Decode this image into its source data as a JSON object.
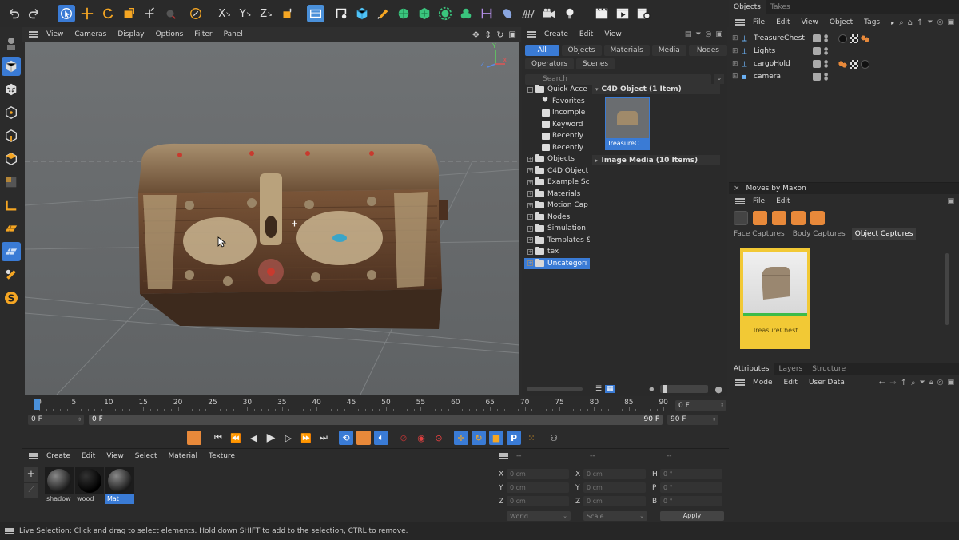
{
  "top_menu": {
    "items": [
      "View",
      "Cameras",
      "Display",
      "Options",
      "Filter",
      "Panel"
    ]
  },
  "viewport": {
    "axis_labels": {
      "x": "X",
      "y": "Y",
      "z": "Z"
    }
  },
  "content_browser": {
    "menu": [
      "Create",
      "Edit",
      "View"
    ],
    "tabs_row1": [
      "All",
      "Objects",
      "Materials",
      "Media",
      "Nodes"
    ],
    "tabs_row2": [
      "Operators",
      "Scenes"
    ],
    "search_placeholder": "Search",
    "tree": [
      {
        "label": "Quick Acce",
        "level": 0,
        "expanded": true
      },
      {
        "label": "Favorites",
        "level": 1,
        "kind": "heart"
      },
      {
        "label": "Incomple",
        "level": 1
      },
      {
        "label": "Keyword",
        "level": 1
      },
      {
        "label": "Recently",
        "level": 1
      },
      {
        "label": "Recently",
        "level": 1
      },
      {
        "label": "Objects",
        "level": 0
      },
      {
        "label": "C4D Object",
        "level": 0
      },
      {
        "label": "Example Sc",
        "level": 0
      },
      {
        "label": "Materials",
        "level": 0
      },
      {
        "label": "Motion Cap",
        "level": 0
      },
      {
        "label": "Nodes",
        "level": 0
      },
      {
        "label": "Simulation",
        "level": 0
      },
      {
        "label": "Templates &",
        "level": 0
      },
      {
        "label": "tex",
        "level": 0
      },
      {
        "label": "Uncategori",
        "level": 0,
        "selected": true
      }
    ],
    "section_c4d": "C4D Object (1 Item)",
    "asset_label": "TreasureC...",
    "section_media": "Image Media (10 Items)"
  },
  "objects_panel": {
    "tabs": [
      "Objects",
      "Takes"
    ],
    "menu": [
      "File",
      "Edit",
      "View",
      "Object",
      "Tags"
    ],
    "rows": [
      {
        "name": "TreasureChest",
        "icon": "null-object-icon",
        "tags": [
          "black-sphere",
          "checker",
          "orange"
        ]
      },
      {
        "name": "Lights",
        "icon": "null-object-icon",
        "tags": []
      },
      {
        "name": "cargoHold",
        "icon": "null-object-icon",
        "tags": [
          "orange",
          "checker",
          "black-sphere"
        ]
      },
      {
        "name": "camera",
        "icon": "camera-icon",
        "tags": []
      }
    ]
  },
  "moves_panel": {
    "title": "Moves by Maxon",
    "menu": [
      "File",
      "Edit"
    ],
    "tabs": [
      "Face Captures",
      "Body Captures",
      "Object Captures"
    ],
    "active_tab": "Object Captures",
    "capture_label": "TreasureChest"
  },
  "attributes_panel": {
    "tabs": [
      "Attributes",
      "Layers",
      "Structure"
    ],
    "menu": [
      "Mode",
      "Edit",
      "User Data"
    ]
  },
  "timeline": {
    "ticks": [
      "0",
      "5",
      "10",
      "15",
      "20",
      "25",
      "30",
      "35",
      "40",
      "45",
      "50",
      "55",
      "60",
      "65",
      "70",
      "75",
      "80",
      "85",
      "90"
    ],
    "start_field": "0 F",
    "range_start": "0 F",
    "range_end": "90 F",
    "current_frame": "0 F",
    "end_field": "90 F"
  },
  "material_manager": {
    "menu": [
      "Create",
      "Edit",
      "View",
      "Select",
      "Material",
      "Texture"
    ],
    "materials": [
      {
        "name": "shadow"
      },
      {
        "name": "wood"
      },
      {
        "name": "Mat",
        "selected": true
      }
    ]
  },
  "coordinates": {
    "header": [
      "--",
      "--",
      "--"
    ],
    "rows": [
      {
        "a_label": "X",
        "a_value": "0 cm",
        "b_label": "X",
        "b_value": "0 cm",
        "c_label": "H",
        "c_value": "0 °"
      },
      {
        "a_label": "Y",
        "a_value": "0 cm",
        "b_label": "Y",
        "b_value": "0 cm",
        "c_label": "P",
        "c_value": "0 °"
      },
      {
        "a_label": "Z",
        "a_value": "0 cm",
        "b_label": "Z",
        "b_value": "0 cm",
        "c_label": "B",
        "c_value": "0 °"
      }
    ],
    "world_select": "World",
    "scale_select": "Scale",
    "apply_label": "Apply"
  },
  "status_bar": {
    "text": "Live Selection: Click and drag to select elements. Hold down SHIFT to add to the selection, CTRL to remove."
  },
  "colors": {
    "accent_blue": "#3a7bd5",
    "viewport_bg": "#6b6e70",
    "capture_yellow": "#f2c935",
    "capture_green": "#3dbb4a"
  }
}
